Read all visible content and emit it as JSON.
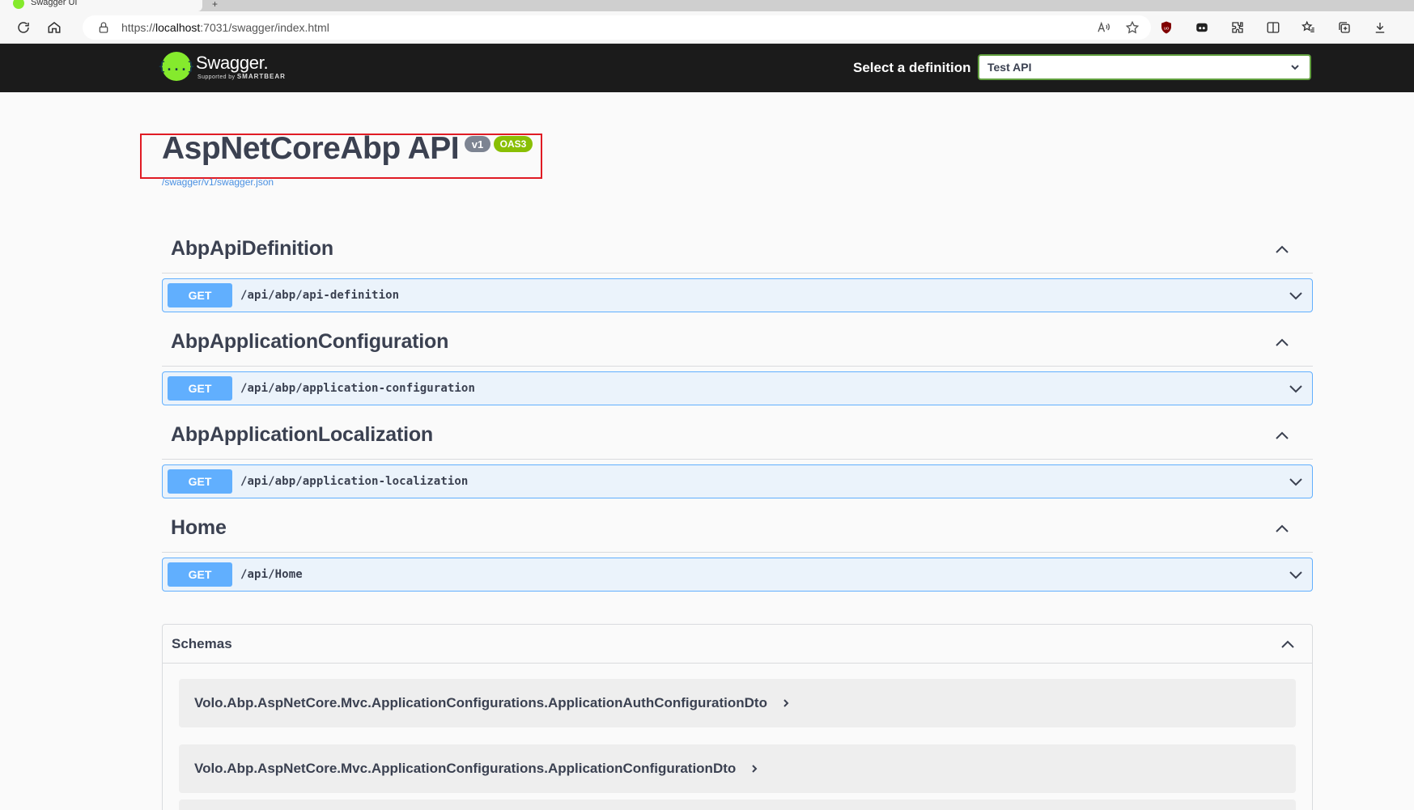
{
  "browser": {
    "tab_title": "Swagger UI",
    "tab_new": "+",
    "url_prefix": "https://",
    "url_host": "localhost",
    "url_rest": ":7031/swagger/index.html"
  },
  "topbar": {
    "logo_symbol": "{...}",
    "logo_text": "Swagger.",
    "logo_sub_prefix": "Supported by",
    "logo_sub_brand": "SMARTBEAR",
    "definition_label": "Select a definition",
    "definition_value": "Test API"
  },
  "info": {
    "title": "AspNetCoreAbp API",
    "version_badge": "v1",
    "oas_badge": "OAS3",
    "spec_link": "/swagger/v1/swagger.json"
  },
  "tags": [
    {
      "name": "AbpApiDefinition",
      "method": "GET",
      "path": "/api/abp/api-definition"
    },
    {
      "name": "AbpApplicationConfiguration",
      "method": "GET",
      "path": "/api/abp/application-configuration"
    },
    {
      "name": "AbpApplicationLocalization",
      "method": "GET",
      "path": "/api/abp/application-localization"
    },
    {
      "name": "Home",
      "method": "GET",
      "path": "/api/Home"
    }
  ],
  "schemas": {
    "title": "Schemas",
    "models": [
      "Volo.Abp.AspNetCore.Mvc.ApplicationConfigurations.ApplicationAuthConfigurationDto",
      "Volo.Abp.AspNetCore.Mvc.ApplicationConfigurations.ApplicationConfigurationDto"
    ]
  },
  "colors": {
    "get_accent": "#61affe",
    "oas_badge": "#89bf04",
    "highlight_box": "#e01b24"
  }
}
